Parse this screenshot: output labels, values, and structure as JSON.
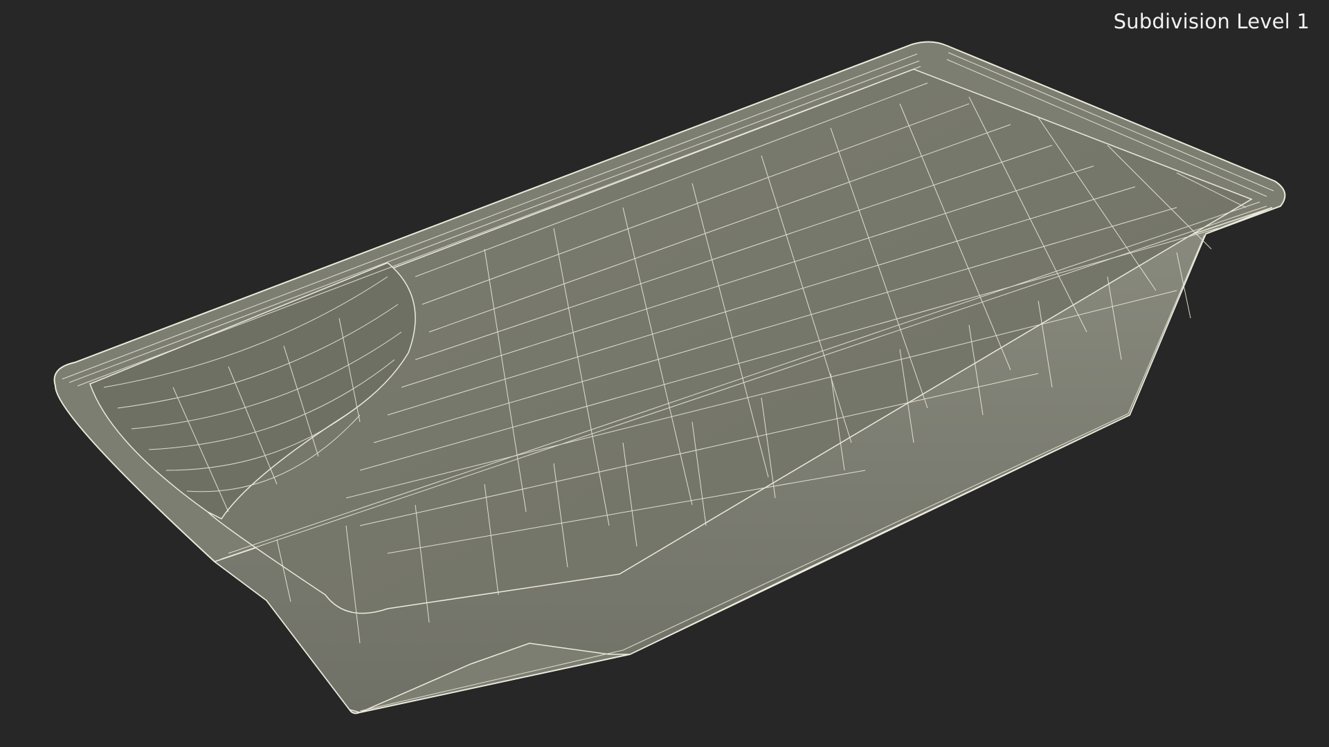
{
  "viewport": {
    "label": "Subdivision Level 1",
    "background_color": "#272727",
    "mesh_fill_color": "#787a6c",
    "wireframe_color": "#ecebdc"
  }
}
